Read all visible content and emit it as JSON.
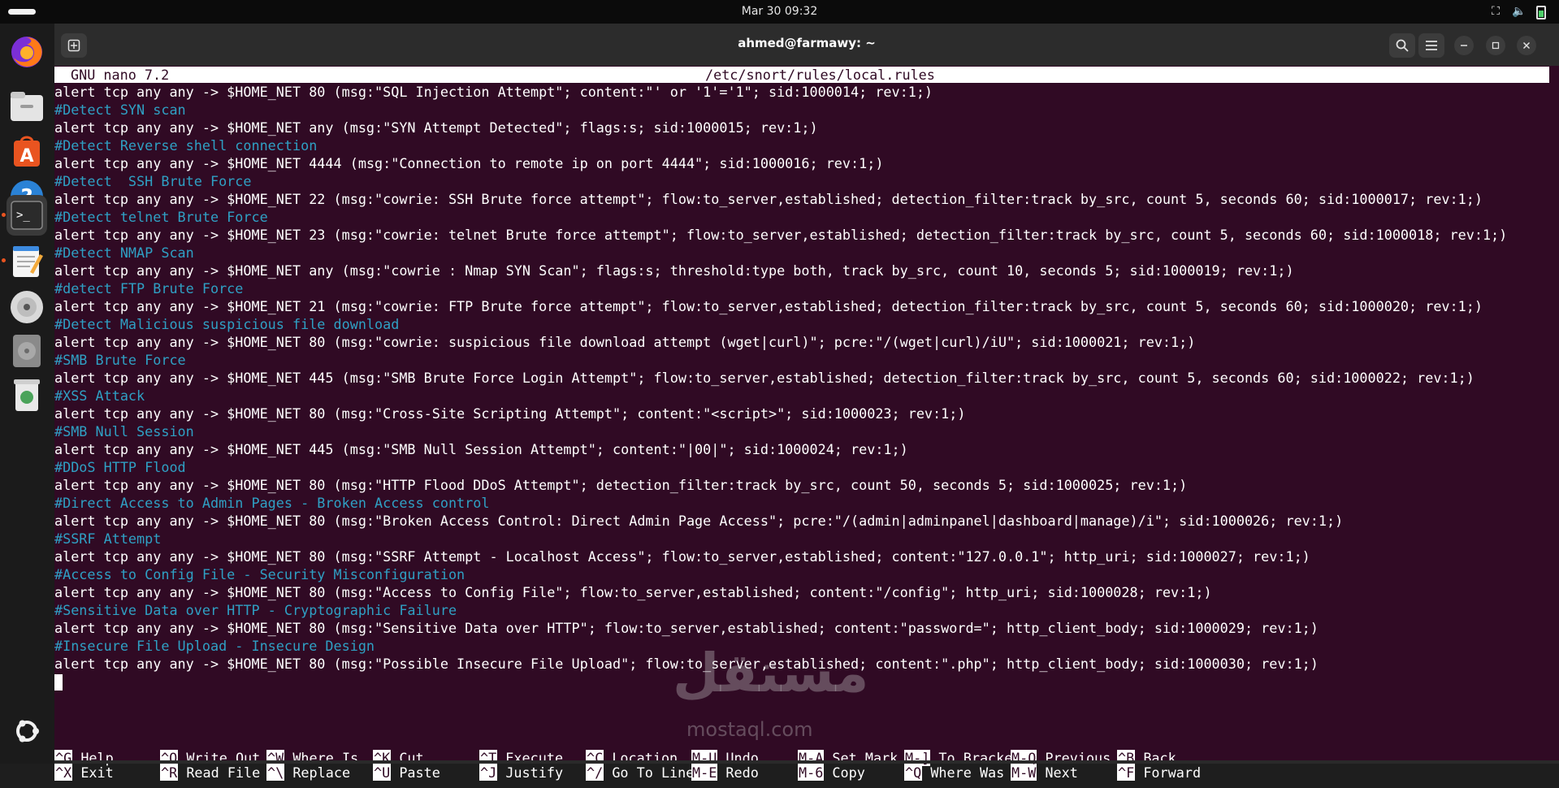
{
  "topbar": {
    "clock": "Mar 30  09:32"
  },
  "dock": {
    "items": [
      {
        "name": "firefox",
        "icon": "firefox-icon"
      },
      {
        "name": "files",
        "icon": "files-icon"
      },
      {
        "name": "app-center",
        "icon": "app-center-icon"
      },
      {
        "name": "help",
        "icon": "help-icon",
        "glyph": "?"
      },
      {
        "name": "terminal",
        "icon": "terminal-icon",
        "glyph": ">_"
      },
      {
        "name": "text-editor",
        "icon": "text-editor-icon"
      },
      {
        "name": "disc",
        "icon": "disc-icon"
      },
      {
        "name": "disk",
        "icon": "disk-icon"
      },
      {
        "name": "trash",
        "icon": "trash-icon"
      }
    ]
  },
  "window": {
    "title": "ahmed@farmawy: ~"
  },
  "nano": {
    "version": "GNU nano 7.2",
    "file": "/etc/snort/rules/local.rules",
    "lines": [
      {
        "text": "alert tcp any any -> $HOME_NET 80 (msg:\"SQL Injection Attempt\"; content:\"' or '1'='1\"; sid:1000014; rev:1;)",
        "type": "rule"
      },
      {
        "text": "#Detect SYN scan",
        "type": "comment"
      },
      {
        "text": "alert tcp any any -> $HOME_NET any (msg:\"SYN Attempt Detected\"; flags:s; sid:1000015; rev:1;)",
        "type": "rule"
      },
      {
        "text": "#Detect Reverse shell connection",
        "type": "comment"
      },
      {
        "text": "alert tcp any any -> $HOME_NET 4444 (msg:\"Connection to remote ip on port 4444\"; sid:1000016; rev:1;)",
        "type": "rule"
      },
      {
        "text": "#Detect  SSH Brute Force",
        "type": "comment"
      },
      {
        "text": "alert tcp any any -> $HOME_NET 22 (msg:\"cowrie: SSH Brute force attempt\"; flow:to_server,established; detection_filter:track by_src, count 5, seconds 60; sid:1000017; rev:1;)",
        "type": "rule"
      },
      {
        "text": "#Detect telnet Brute Force",
        "type": "comment"
      },
      {
        "text": "alert tcp any any -> $HOME_NET 23 (msg:\"cowrie: telnet Brute force attempt\"; flow:to_server,established; detection_filter:track by_src, count 5, seconds 60; sid:1000018; rev:1;)",
        "type": "rule"
      },
      {
        "text": "#Detect NMAP Scan",
        "type": "comment"
      },
      {
        "text": "alert tcp any any -> $HOME_NET any (msg:\"cowrie : Nmap SYN Scan\"; flags:s; threshold:type both, track by_src, count 10, seconds 5; sid:1000019; rev:1;)",
        "type": "rule"
      },
      {
        "text": "#detect FTP Brute Force",
        "type": "comment"
      },
      {
        "text": "alert tcp any any -> $HOME_NET 21 (msg:\"cowrie: FTP Brute force attempt\"; flow:to_server,established; detection_filter:track by_src, count 5, seconds 60; sid:1000020; rev:1;)",
        "type": "rule"
      },
      {
        "text": "#Detect Malicious suspicious file download",
        "type": "comment"
      },
      {
        "text": "alert tcp any any -> $HOME_NET 80 (msg:\"cowrie: suspicious file download attempt (wget|curl)\"; pcre:\"/(wget|curl)/iU\"; sid:1000021; rev:1;)",
        "type": "rule"
      },
      {
        "text": "#SMB Brute Force",
        "type": "comment"
      },
      {
        "text": "alert tcp any any -> $HOME_NET 445 (msg:\"SMB Brute Force Login Attempt\"; flow:to_server,established; detection_filter:track by_src, count 5, seconds 60; sid:1000022; rev:1;)",
        "type": "rule"
      },
      {
        "text": "#XSS Attack",
        "type": "comment"
      },
      {
        "text": "alert tcp any any -> $HOME_NET 80 (msg:\"Cross-Site Scripting Attempt\"; content:\"<script>\"; sid:1000023; rev:1;)",
        "type": "rule"
      },
      {
        "text": "#SMB Null Session",
        "type": "comment"
      },
      {
        "text": "alert tcp any any -> $HOME_NET 445 (msg:\"SMB Null Session Attempt\"; content:\"|00|\"; sid:1000024; rev:1;)",
        "type": "rule"
      },
      {
        "text": "#DDoS HTTP Flood",
        "type": "comment"
      },
      {
        "text": "alert tcp any any -> $HOME_NET 80 (msg:\"HTTP Flood DDoS Attempt\"; detection_filter:track by_src, count 50, seconds 5; sid:1000025; rev:1;)",
        "type": "rule"
      },
      {
        "text": "#Direct Access to Admin Pages - Broken Access control",
        "type": "comment"
      },
      {
        "text": "alert tcp any any -> $HOME_NET 80 (msg:\"Broken Access Control: Direct Admin Page Access\"; pcre:\"/(admin|adminpanel|dashboard|manage)/i\"; sid:1000026; rev:1;)",
        "type": "rule"
      },
      {
        "text": "#SSRF Attempt",
        "type": "comment"
      },
      {
        "text": "alert tcp any any -> $HOME_NET 80 (msg:\"SSRF Attempt - Localhost Access\"; flow:to_server,established; content:\"127.0.0.1\"; http_uri; sid:1000027; rev:1;)",
        "type": "rule"
      },
      {
        "text": "#Access to Config File - Security Misconfiguration",
        "type": "comment"
      },
      {
        "text": "alert tcp any any -> $HOME_NET 80 (msg:\"Access to Config File\"; flow:to_server,established; content:\"/config\"; http_uri; sid:1000028; rev:1;)",
        "type": "rule"
      },
      {
        "text": "#Sensitive Data over HTTP - Cryptographic Failure",
        "type": "comment"
      },
      {
        "text": "alert tcp any any -> $HOME_NET 80 (msg:\"Sensitive Data over HTTP\"; flow:to_server,established; content:\"password=\"; http_client_body; sid:1000029; rev:1;)",
        "type": "rule"
      },
      {
        "text": "#Insecure File Upload - Insecure Design",
        "type": "comment"
      },
      {
        "text": "alert tcp any any -> $HOME_NET 80 (msg:\"Possible Insecure File Upload\"; flow:to_server,established; content:\".php\"; http_client_body; sid:1000030; rev:1;)",
        "type": "rule"
      }
    ],
    "shortcuts": [
      {
        "key": "^G",
        "label": "Help"
      },
      {
        "key": "^X",
        "label": "Exit"
      },
      {
        "key": "^O",
        "label": "Write Out"
      },
      {
        "key": "^R",
        "label": "Read File"
      },
      {
        "key": "^W",
        "label": "Where Is"
      },
      {
        "key": "^\\",
        "label": "Replace"
      },
      {
        "key": "^K",
        "label": "Cut"
      },
      {
        "key": "^U",
        "label": "Paste"
      },
      {
        "key": "^T",
        "label": "Execute"
      },
      {
        "key": "^J",
        "label": "Justify"
      },
      {
        "key": "^C",
        "label": "Location"
      },
      {
        "key": "^/",
        "label": "Go To Line"
      },
      {
        "key": "M-U",
        "label": "Undo"
      },
      {
        "key": "M-E",
        "label": "Redo"
      },
      {
        "key": "M-A",
        "label": "Set Mark"
      },
      {
        "key": "M-6",
        "label": "Copy"
      },
      {
        "key": "M-]",
        "label": "To Bracket"
      },
      {
        "key": "^Q",
        "label": "Where Was"
      },
      {
        "key": "M-Q",
        "label": "Previous"
      },
      {
        "key": "M-W",
        "label": "Next"
      },
      {
        "key": "^B",
        "label": "Back"
      },
      {
        "key": "^F",
        "label": "Forward"
      }
    ]
  },
  "watermark": {
    "main": "مستقل",
    "sub": "mostaql.com"
  }
}
